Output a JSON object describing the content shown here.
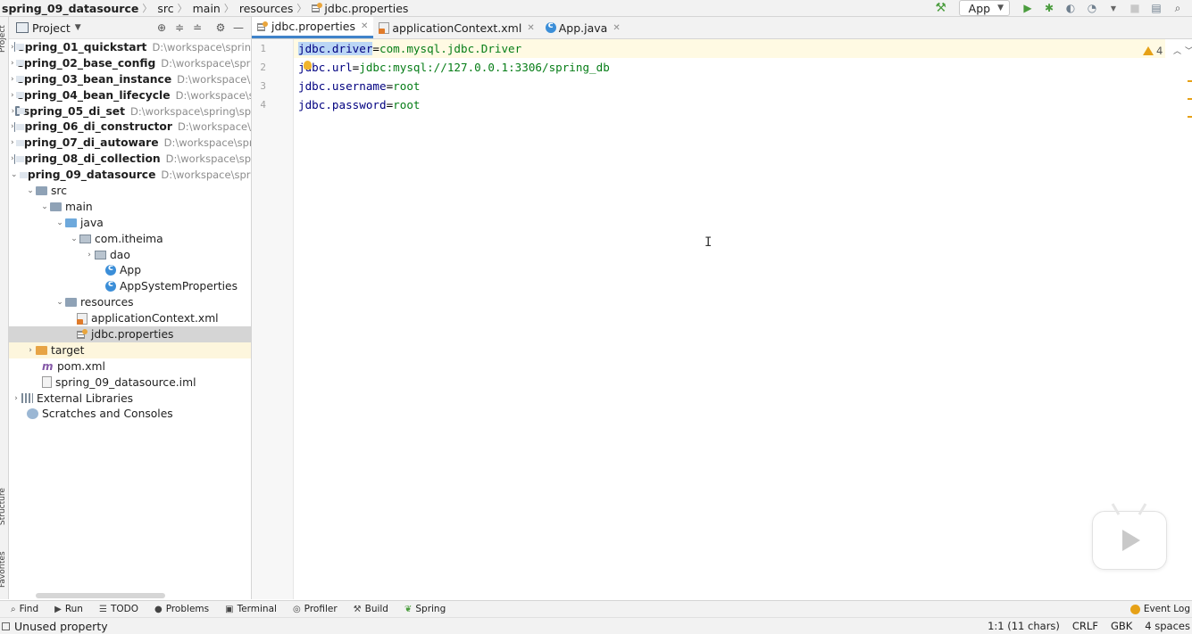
{
  "navbar": {
    "breadcrumbs": [
      "spring_09_datasource",
      "src",
      "main",
      "resources",
      "jdbc.properties"
    ],
    "run_config": "App"
  },
  "left_stripe": {
    "labels": [
      "Project",
      "Structure",
      "Favorites"
    ]
  },
  "project_panel": {
    "title": "Project",
    "tree": [
      {
        "label": "spring_01_quickstart",
        "path": "D:\\workspace\\sprin"
      },
      {
        "label": "spring_02_base_config",
        "path": "D:\\workspace\\spri"
      },
      {
        "label": "spring_03_bean_instance",
        "path": "D:\\workspace\\s"
      },
      {
        "label": "spring_04_bean_lifecycle",
        "path": "D:\\workspace\\sp"
      },
      {
        "label": "spring_05_di_set",
        "path": "D:\\workspace\\spring\\sp"
      },
      {
        "label": "spring_06_di_constructor",
        "path": "D:\\workspace\\"
      },
      {
        "label": "spring_07_di_autoware",
        "path": "D:\\workspace\\spr"
      },
      {
        "label": "spring_08_di_collection",
        "path": "D:\\workspace\\sp"
      },
      {
        "label": "spring_09_datasource",
        "path": "D:\\workspace\\sprir"
      },
      {
        "label": "src"
      },
      {
        "label": "main"
      },
      {
        "label": "java"
      },
      {
        "label": "com.itheima"
      },
      {
        "label": "dao"
      },
      {
        "label": "App"
      },
      {
        "label": "AppSystemProperties"
      },
      {
        "label": "resources"
      },
      {
        "label": "applicationContext.xml"
      },
      {
        "label": "jdbc.properties"
      },
      {
        "label": "target"
      },
      {
        "label": "pom.xml"
      },
      {
        "label": "spring_09_datasource.iml"
      },
      {
        "label": "External Libraries"
      },
      {
        "label": "Scratches and Consoles"
      }
    ]
  },
  "editor_tabs": [
    {
      "label": "jdbc.properties",
      "active": true
    },
    {
      "label": "applicationContext.xml",
      "active": false
    },
    {
      "label": "App.java",
      "active": false
    }
  ],
  "editor": {
    "line_numbers": [
      "1",
      "2",
      "3",
      "4"
    ],
    "lines": [
      {
        "key": "jdbc.driver",
        "eq": "=",
        "value": "com.mysql.jdbc.Driver"
      },
      {
        "key": "jdbc.url",
        "eq": "=",
        "value": "jdbc:mysql://127.0.0.1:3306/spring_db"
      },
      {
        "key": "jdbc.username",
        "eq": "=",
        "value": "root"
      },
      {
        "key": "jdbc.password",
        "eq": "=",
        "value": "root"
      }
    ],
    "warning_count": "4"
  },
  "bottom_tools": [
    "Find",
    "Run",
    "TODO",
    "Problems",
    "Terminal",
    "Profiler",
    "Build",
    "Spring"
  ],
  "event_log": "Event Log",
  "status": {
    "message": "Unused property",
    "position": "1:1 (11 chars)",
    "line_sep": "CRLF",
    "encoding": "GBK",
    "indent": "4 spaces"
  },
  "colors": {
    "selection": "#bad6f5",
    "key": "#000080",
    "value": "#067d17",
    "tab_underline": "#4083c9",
    "warning": "#e6a117"
  }
}
